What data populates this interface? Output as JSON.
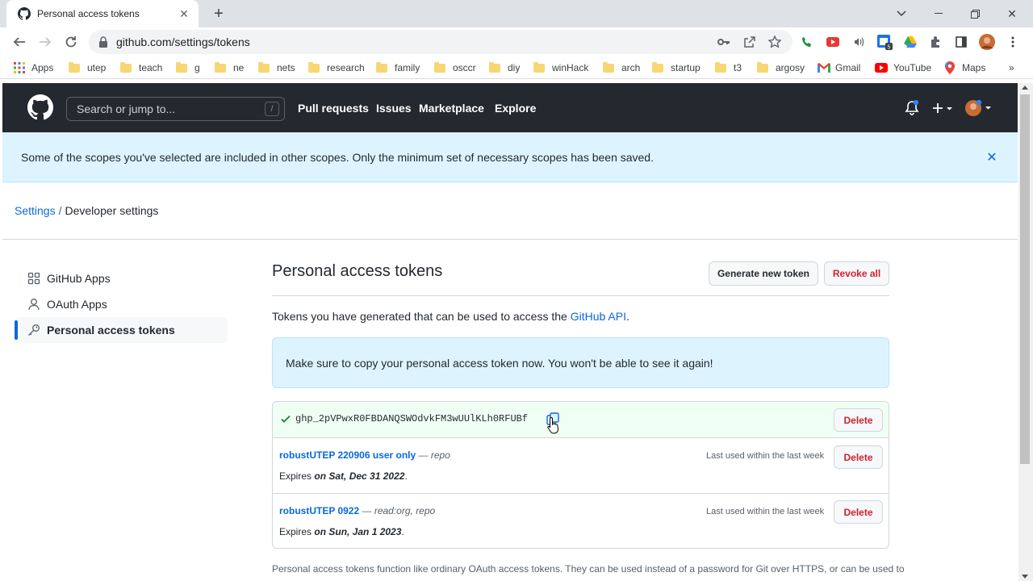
{
  "browser": {
    "tab_title": "Personal access tokens",
    "url": "github.com/settings/tokens",
    "bookmarks": [
      "Apps",
      "utep",
      "teach",
      "g",
      "ne",
      "nets",
      "research",
      "family",
      "osccr",
      "diy",
      "winHack",
      "arch",
      "startup",
      "t3",
      "argosy",
      "Gmail",
      "YouTube",
      "Maps"
    ],
    "more_bookmarks": "»"
  },
  "header": {
    "search_placeholder": "Search or jump to...",
    "search_shortcut": "/",
    "nav": [
      "Pull requests",
      "Issues",
      "Marketplace",
      "Explore"
    ]
  },
  "flash": {
    "message": "Some of the scopes you've selected are included in other scopes. Only the minimum set of necessary scopes has been saved."
  },
  "breadcrumb": {
    "parent": "Settings",
    "separator": "/",
    "current": "Developer settings"
  },
  "sidebar": {
    "items": [
      {
        "label": "GitHub Apps",
        "icon": "apps-grid-icon"
      },
      {
        "label": "OAuth Apps",
        "icon": "person-icon"
      },
      {
        "label": "Personal access tokens",
        "icon": "key-icon",
        "active": true
      }
    ]
  },
  "main": {
    "title": "Personal access tokens",
    "generate_label": "Generate new token",
    "revoke_label": "Revoke all",
    "intro_text": "Tokens you have generated that can be used to access the ",
    "intro_link": "GitHub API",
    "intro_end": ".",
    "notice": "Make sure to copy your personal access token now. You won't be able to see it again!",
    "new_token": {
      "value": "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",
      "delete_label": "Delete"
    },
    "tokens": [
      {
        "name": "robustUTEP 220906 user only",
        "scopes": " — repo",
        "expires_prefix": "Expires ",
        "expires": "on Sat, Dec 31 2022",
        "expires_suffix": ".",
        "last_used": "Last used within the last week",
        "delete_label": "Delete"
      },
      {
        "name": "robustUTEP 0922",
        "scopes": " — read:org, repo",
        "expires_prefix": "Expires ",
        "expires": "on Sun, Jan 1 2023",
        "expires_suffix": ".",
        "last_used": "Last used within the last week",
        "delete_label": "Delete"
      }
    ],
    "footnote": "Personal access tokens function like ordinary OAuth access tokens. They can be used instead of a password for Git over HTTPS, or can be used to"
  },
  "colors": {
    "accent": "#0969da",
    "danger": "#cf222e",
    "header_bg": "#24292f",
    "flash_bg": "#ddf4ff",
    "success": "#1a7f37"
  }
}
